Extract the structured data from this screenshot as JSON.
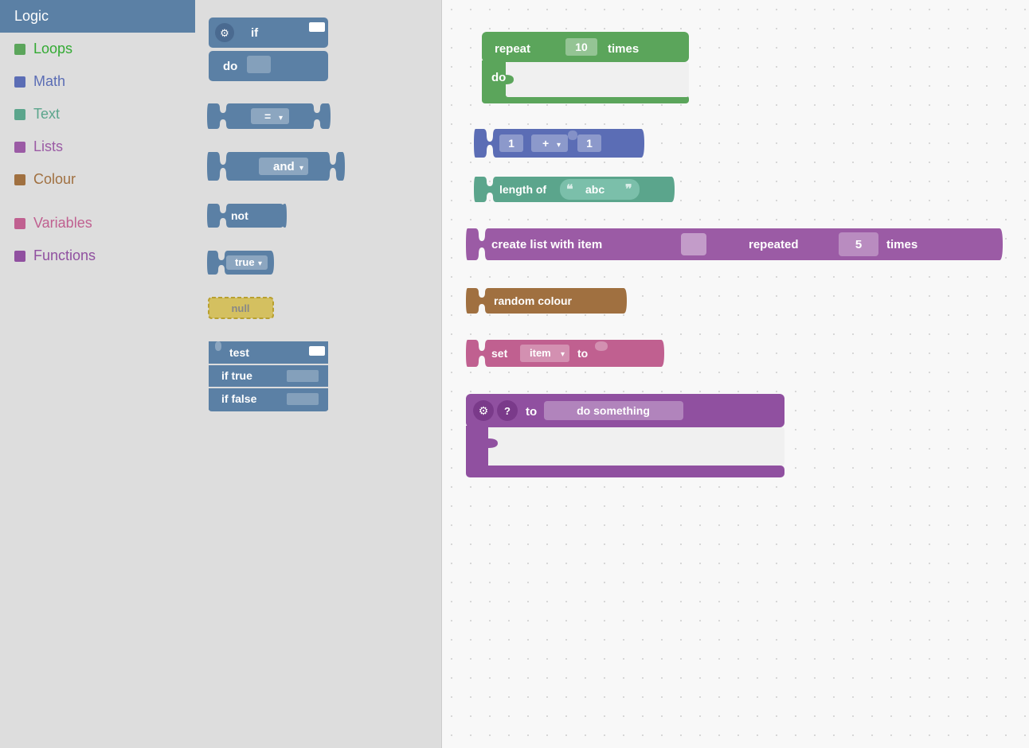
{
  "sidebar": {
    "items": [
      {
        "id": "logic",
        "label": "Logic",
        "color": "#5b80a5",
        "active": true
      },
      {
        "id": "loops",
        "label": "Loops",
        "color": "#5ba55b"
      },
      {
        "id": "math",
        "label": "Math",
        "color": "#5b6db5"
      },
      {
        "id": "text",
        "label": "Text",
        "color": "#5ba58c"
      },
      {
        "id": "lists",
        "label": "Lists",
        "color": "#9b5ba5"
      },
      {
        "id": "colour",
        "label": "Colour",
        "color": "#a07040"
      },
      {
        "id": "variables",
        "label": "Variables",
        "color": "#c06090"
      },
      {
        "id": "functions",
        "label": "Functions",
        "color": "#9050a0"
      }
    ]
  },
  "palette": {
    "blocks": [
      {
        "id": "if-block",
        "type": "logic",
        "label_top": "if",
        "label_bottom": "do"
      },
      {
        "id": "eq-block",
        "type": "logic",
        "label": "="
      },
      {
        "id": "and-block",
        "type": "logic",
        "label": "and"
      },
      {
        "id": "not-block",
        "type": "logic",
        "label": "not"
      },
      {
        "id": "true-block",
        "type": "logic",
        "label": "true"
      },
      {
        "id": "null-block",
        "type": "null",
        "label": "null"
      },
      {
        "id": "ternary-block",
        "type": "logic",
        "label_test": "test",
        "label_iftrue": "if true",
        "label_iffalse": "if false"
      }
    ]
  },
  "workspace": {
    "blocks": [
      {
        "id": "repeat-block",
        "type": "loops",
        "label": "repeat",
        "value": "10",
        "label2": "times",
        "label3": "do"
      },
      {
        "id": "math-add-block",
        "type": "math",
        "val1": "1",
        "op": "+",
        "val2": "1"
      },
      {
        "id": "length-block",
        "type": "text",
        "label": "length of",
        "value": "abc"
      },
      {
        "id": "create-list-block",
        "type": "lists",
        "label": "create list with item",
        "label2": "repeated",
        "value": "5",
        "label3": "times"
      },
      {
        "id": "random-colour-block",
        "type": "colour",
        "label": "random colour"
      },
      {
        "id": "set-item-block",
        "type": "variables",
        "label": "set",
        "dropdown": "item",
        "label2": "to"
      },
      {
        "id": "function-block",
        "type": "functions",
        "label": "to",
        "name": "do something"
      }
    ]
  },
  "icons": {
    "gear": "⚙",
    "question": "?",
    "dropdown_arrow": "▾"
  }
}
